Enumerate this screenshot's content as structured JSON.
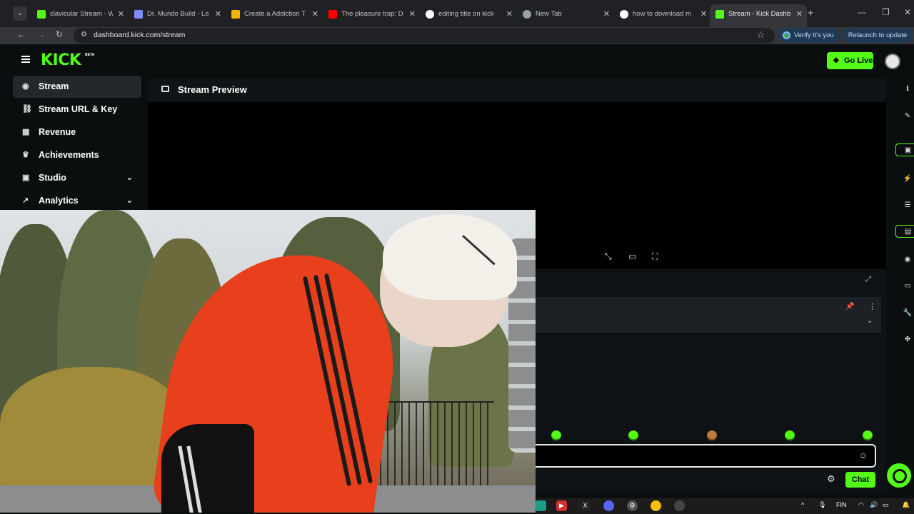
{
  "browser": {
    "tabs": [
      {
        "title": "clavicular Stream - W",
        "favicon": "kick-icon",
        "color": "#53fc18"
      },
      {
        "title": "Dr. Mundo Build - Le",
        "favicon": "shield-icon",
        "color": "#7f8cff"
      },
      {
        "title": "Create a Addiction T",
        "favicon": "doc-icon",
        "color": "#f5b400"
      },
      {
        "title": "The pleasure trap: D",
        "favicon": "youtube-icon",
        "color": "#ff0000"
      },
      {
        "title": "editing title on kick",
        "favicon": "google-icon",
        "color": "#ffffff"
      },
      {
        "title": "New Tab",
        "favicon": "chrome-icon",
        "color": "#9aa0a6"
      },
      {
        "title": "how to download m",
        "favicon": "google-icon",
        "color": "#ffffff"
      },
      {
        "title": "Stream - Kick Dashb",
        "favicon": "kick-icon",
        "color": "#53fc18",
        "active": true
      }
    ],
    "url": "dashboard.kick.com/stream",
    "verify_label": "Verify it's you",
    "relaunch_label": "Relaunch to update"
  },
  "header": {
    "logo": "KICK",
    "logo_badge": "BETA",
    "go_live_label": "Go Live"
  },
  "sidebar": {
    "items": [
      {
        "label": "Stream",
        "icon": "stream-icon"
      },
      {
        "label": "Stream URL & Key",
        "icon": "link-icon"
      },
      {
        "label": "Revenue",
        "icon": "revenue-icon"
      },
      {
        "label": "Achievements",
        "icon": "trophy-icon"
      },
      {
        "label": "Studio",
        "icon": "studio-icon"
      },
      {
        "label": "Analytics",
        "icon": "analytics-icon"
      }
    ]
  },
  "main": {
    "preview_title": "Stream Preview",
    "chat_button": "Chat"
  },
  "taskbar": {
    "language": "FIN"
  },
  "colors": {
    "accent": "#53fc18",
    "background": "#0b0e0f"
  }
}
